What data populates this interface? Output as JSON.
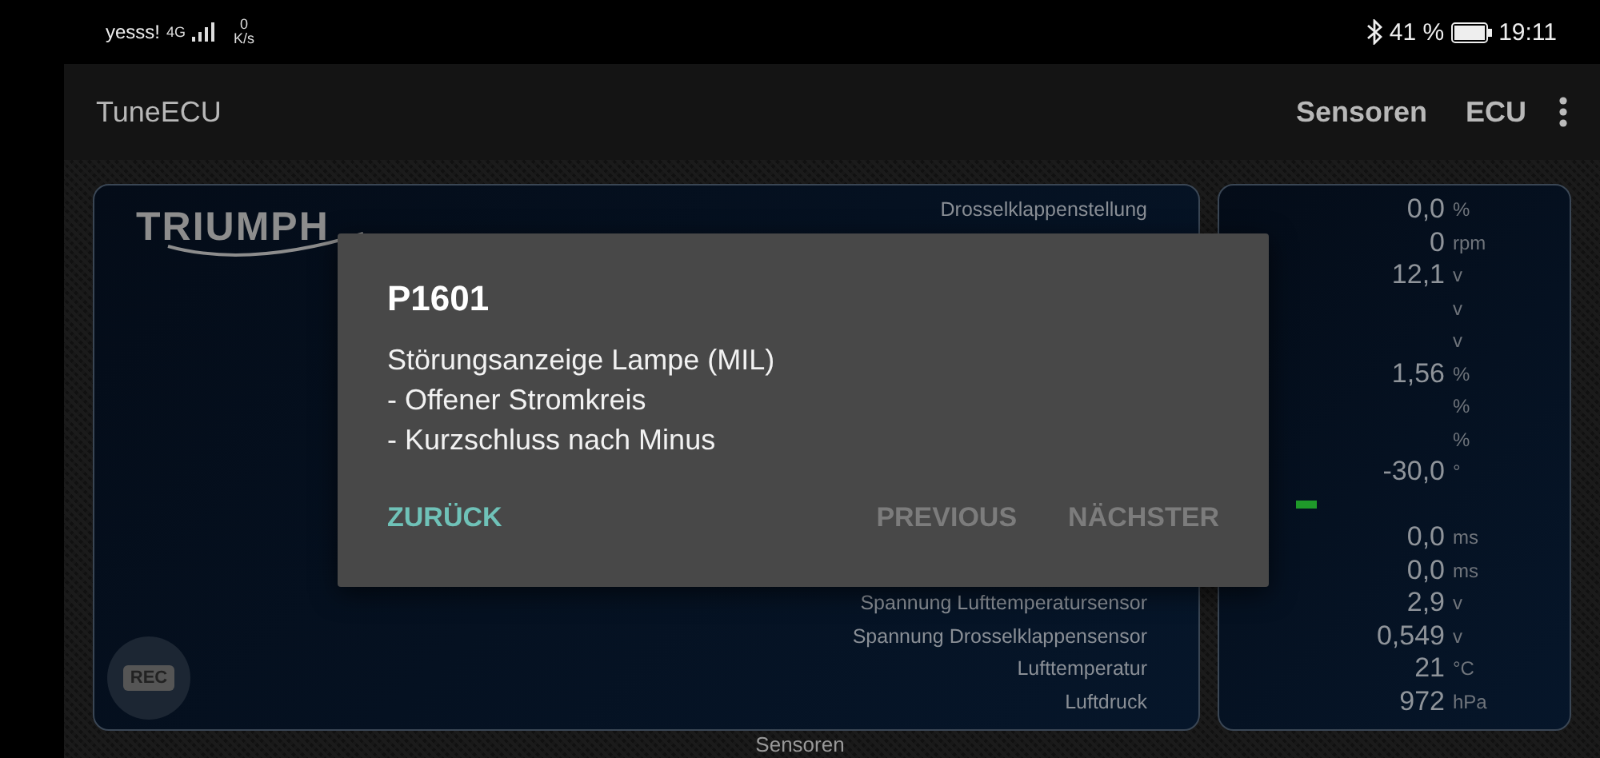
{
  "status_bar": {
    "carrier": "yesss!",
    "network": "4G",
    "speed": "0",
    "speed_unit": "K/s",
    "battery": "41 %",
    "time": "19:11"
  },
  "app_bar": {
    "title": "TuneECU",
    "actions": [
      "Sensoren",
      "ECU"
    ]
  },
  "logo": {
    "text": "TRIUMPH"
  },
  "sensors": [
    {
      "label": "Drosselklappenstellung",
      "value": "0,0",
      "unit": "%"
    },
    {
      "value": "0",
      "unit": "rpm"
    },
    {
      "value": "12,1",
      "unit": "v"
    },
    {
      "unit": "v"
    },
    {
      "unit": "v"
    },
    {
      "value": "1,56",
      "unit": "%"
    },
    {
      "unit": "%"
    },
    {
      "unit": "%"
    },
    {
      "value": "-30,0",
      "unit": "°"
    },
    {
      "kind": "bar"
    },
    {
      "value": "0,0",
      "unit": "ms"
    },
    {
      "value": "0,0",
      "unit": "ms"
    },
    {
      "label": "Spannung Lufttemperatursensor",
      "value": "2,9",
      "unit": "v"
    },
    {
      "label": "Spannung Drosselklappensensor",
      "value": "0,549",
      "unit": "v"
    },
    {
      "label": "Lufttemperatur",
      "value": "21",
      "unit": "°C"
    },
    {
      "label": "Luftdruck",
      "value": "972",
      "unit": "hPa"
    }
  ],
  "rec_button": {
    "label": "REC"
  },
  "footer": {
    "label": "Sensoren"
  },
  "dialog": {
    "title": "P1601",
    "message": "Störungsanzeige Lampe (MIL)\n- Offener Stromkreis\n- Kurzschluss nach Minus",
    "buttons": [
      {
        "label": "ZURÜCK",
        "disabled": false
      },
      {
        "label": "PREVIOUS",
        "disabled": true
      },
      {
        "label": "NÄCHSTER",
        "disabled": true
      }
    ]
  }
}
